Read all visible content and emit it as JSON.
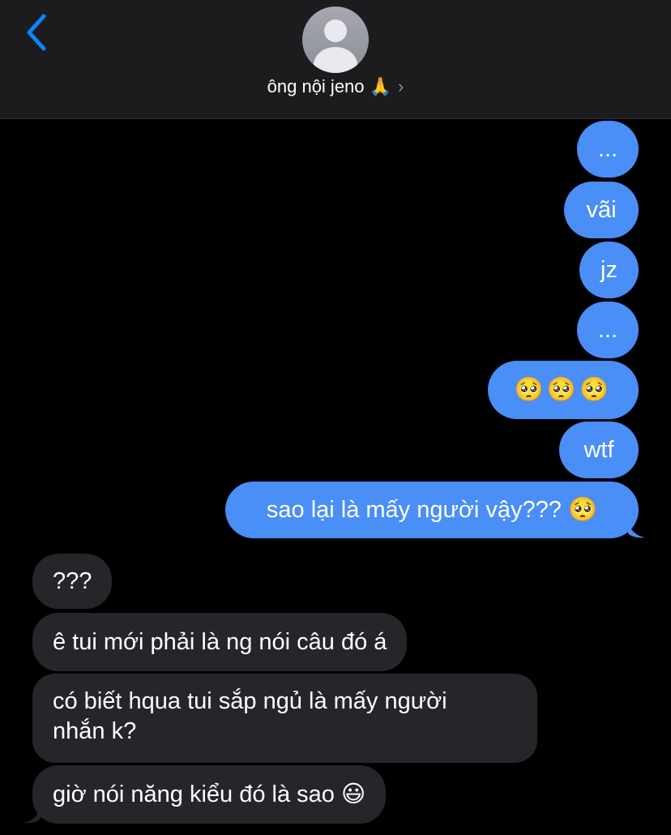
{
  "header": {
    "contact_name": "ông nội jeno 🙏",
    "chevron": "›",
    "back_icon": "chevron-left-icon",
    "accent": "#0a84ff"
  },
  "colors": {
    "sent_bubble": "#4a8ef7",
    "received_bubble": "#26252a",
    "background": "#000000"
  },
  "messages": {
    "sent": [
      "...",
      "vãi",
      "jz",
      "...",
      "🥺🥺🥺",
      "wtf",
      "sao lại là mấy người vậy??? 🥺"
    ],
    "received": [
      "???",
      "ê tui mới phải là ng nói câu đó á",
      "có biết hqua tui sắp ngủ là mấy người",
      "nhắn k?",
      "giờ nói năng kiểu đó là sao 😃"
    ]
  }
}
